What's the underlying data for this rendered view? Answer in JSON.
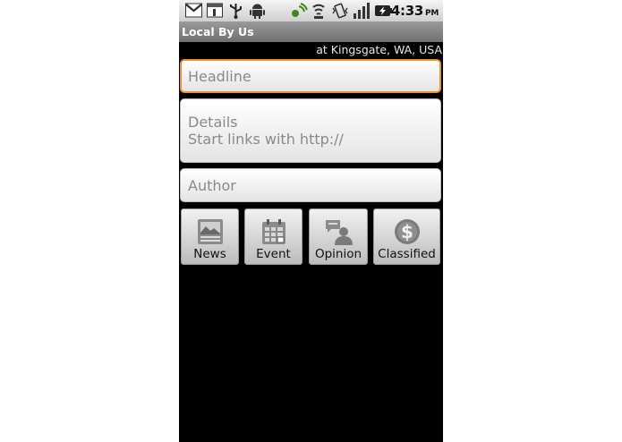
{
  "status_bar": {
    "time": "4:33",
    "ampm": "PM",
    "icons": [
      "gmail-icon",
      "calendar-icon",
      "usb-icon",
      "android-icon",
      "gps-icon",
      "wifi-icon",
      "vibrate-icon",
      "signal-icon",
      "battery-charging-icon"
    ]
  },
  "app": {
    "title": "Local By Us",
    "location": "at Kingsgate, WA, USA"
  },
  "form": {
    "headline_placeholder": "Headline",
    "details_placeholder_line1": "Details",
    "details_placeholder_line2": "Start links with http://",
    "author_placeholder": "Author"
  },
  "categories": [
    {
      "label": "News",
      "icon": "news-icon"
    },
    {
      "label": "Event",
      "icon": "calendar-grid-icon"
    },
    {
      "label": "Opinion",
      "icon": "opinion-icon"
    },
    {
      "label": "Classified",
      "icon": "dollar-coin-icon"
    }
  ],
  "colors": {
    "focus_border": "#f0902a",
    "background": "#000000"
  }
}
